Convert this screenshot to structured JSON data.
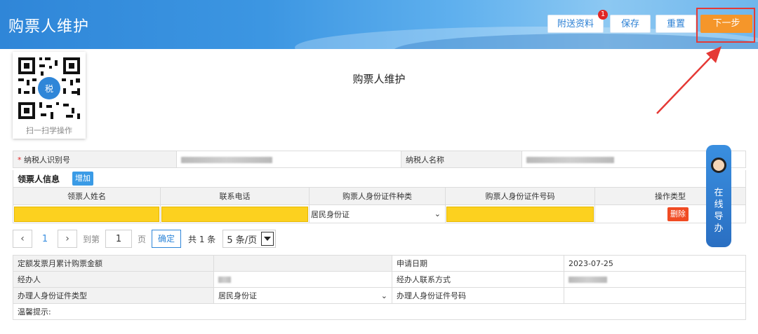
{
  "header": {
    "title": "购票人维护",
    "buttons": {
      "attach": "附送资料",
      "attach_badge": "1",
      "save": "保存",
      "reset": "重置",
      "next": "下一步"
    }
  },
  "qr": {
    "label": "扫一扫学操作"
  },
  "page_title": "购票人维护",
  "taxpayer": {
    "id_label": "纳税人识别号",
    "required_mark": "*",
    "name_label": "纳税人名称"
  },
  "recipient_section": {
    "title": "领票人信息",
    "add_button": "增加",
    "columns": [
      "领票人姓名",
      "联系电话",
      "购票人身份证件种类",
      "购票人身份证件号码",
      "操作类型"
    ],
    "row": {
      "id_type": "居民身份证",
      "delete_button": "删除"
    }
  },
  "pager": {
    "current": "1",
    "goto_prefix": "到第",
    "goto_value": "1",
    "goto_suffix": "页",
    "confirm": "确定",
    "total": "共 1 条",
    "page_size": "5 条/页"
  },
  "details": {
    "quota_label": "定额发票月累计购票金额",
    "apply_date_label": "申请日期",
    "apply_date_value": "2023-07-25",
    "handler_label": "经办人",
    "handler_contact_label": "经办人联系方式",
    "handler_id_type_label": "办理人身份证件类型",
    "handler_id_type_value": "居民身份证",
    "handler_id_number_label": "办理人身份证件号码",
    "tips_label": "温馨提示:"
  },
  "guide": {
    "text": "在线导办"
  },
  "colors": {
    "primary": "#2f86d8",
    "next": "#f5962a",
    "highlight": "#e53935",
    "required": "#fcd11f",
    "delete": "#f04b23"
  }
}
